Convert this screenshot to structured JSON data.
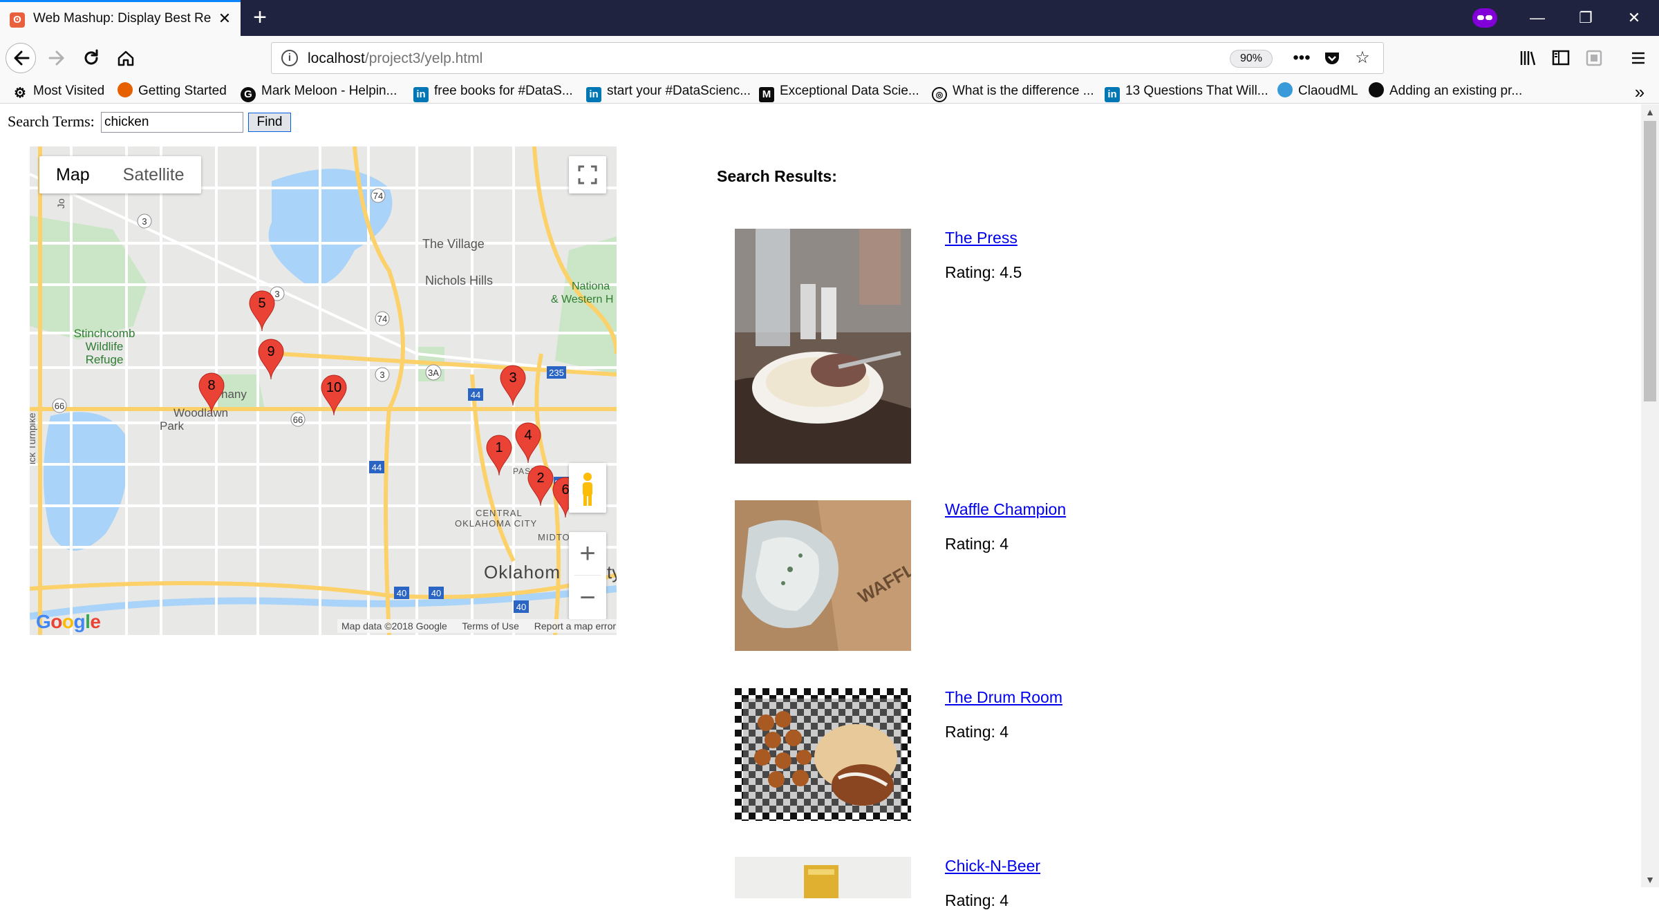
{
  "browser": {
    "tab_title": "Web Mashup: Display Best Rest",
    "tab_close": "✕",
    "new_tab": "+",
    "url_host": "localhost",
    "url_path": "/project3/yelp.html",
    "zoom": "90%",
    "window_minimize": "—",
    "window_restore": "❐",
    "window_close": "✕"
  },
  "bookmarks": [
    {
      "label": "Most Visited",
      "icon": "gear-icon"
    },
    {
      "label": "Getting Started",
      "icon": "firefox-icon"
    },
    {
      "label": "Mark Meloon - Helpin...",
      "icon": "g-icon"
    },
    {
      "label": "free books for #DataS...",
      "icon": "linkedin-icon"
    },
    {
      "label": "start your #DataScienc...",
      "icon": "linkedin-icon"
    },
    {
      "label": "Exceptional Data Scie...",
      "icon": "medium-icon"
    },
    {
      "label": "What is the difference ...",
      "icon": "globe-icon"
    },
    {
      "label": "13 Questions That Will...",
      "icon": "linkedin-icon"
    },
    {
      "label": "ClaoudML",
      "icon": "cloud-icon"
    },
    {
      "label": "Adding an existing pr...",
      "icon": "github-icon"
    }
  ],
  "search": {
    "label": "Search Terms:",
    "value": "chicken",
    "find_label": "Find"
  },
  "map": {
    "type_map": "Map",
    "type_satellite": "Satellite",
    "zoom_in": "+",
    "zoom_out": "−",
    "logo": "Google",
    "attribution": "Map data ©2018 Google",
    "terms": "Terms of Use",
    "report": "Report a map error",
    "place_labels": [
      "The Village",
      "Nichols Hills",
      "Nationa",
      "& Western H",
      "Stinchcomb",
      "Wildlife",
      "Refuge",
      "hany",
      "Woodlawn",
      "Park",
      "CENTRAL",
      "OKLAHOMA CITY",
      "MIDTOWN",
      "Oklahom",
      "ty",
      "PASEO",
      "ick Turnpike",
      "Jo"
    ],
    "road_shields": [
      "74",
      "3",
      "3",
      "74",
      "3",
      "3A",
      "235",
      "44",
      "66",
      "66",
      "44",
      "235",
      "40",
      "40",
      "40"
    ],
    "markers": [
      "1",
      "2",
      "3",
      "4",
      "5",
      "6",
      "8",
      "9",
      "10"
    ]
  },
  "results": {
    "heading": "Search Results:",
    "items": [
      {
        "name": "The Press",
        "rating": "Rating: 4.5"
      },
      {
        "name": "Waffle Champion",
        "rating": "Rating: 4"
      },
      {
        "name": "The Drum Room",
        "rating": "Rating: 4"
      },
      {
        "name": "Chick-N-Beer",
        "rating": "Rating: 4"
      }
    ]
  }
}
